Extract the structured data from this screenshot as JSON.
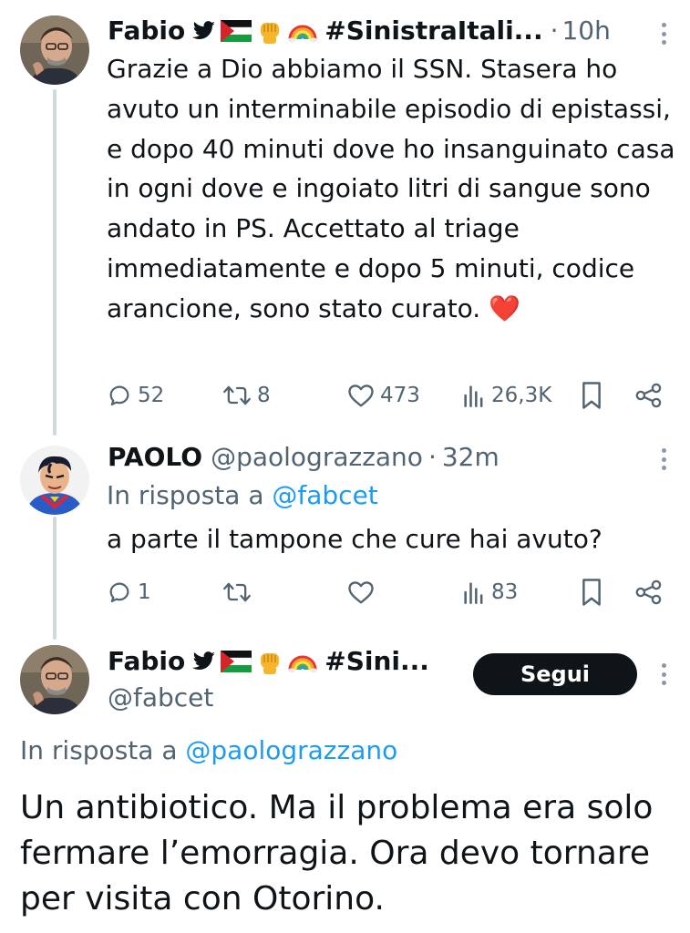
{
  "tweet1": {
    "name": "Fabio",
    "flair_tag": "#SinistraItali...",
    "separator": "·",
    "time": "10h",
    "text": "Grazie a Dio abbiamo il SSN. Stasera ho avuto un interminabile episodio di epistassi, e dopo 40 minuti dove ho insanguinato casa in ogni dove e ingoiato litri di sangue sono andato in PS. Accettato al triage immediatamente e dopo 5 minuti, codice arancione, sono stato curato. ❤️",
    "replies": "52",
    "retweets": "8",
    "likes": "473",
    "views": "26,3K"
  },
  "tweet2": {
    "name": "PAOLO",
    "handle": "@paolograzzano",
    "separator": "·",
    "time": "32m",
    "reply_prefix": "In risposta a",
    "reply_mention": "@fabcet",
    "text": "a parte il tampone che cure hai avuto?",
    "replies": "1",
    "retweets": "",
    "likes": "",
    "views": "83"
  },
  "main_tweet": {
    "name": "Fabio",
    "flair_tag": "#Sini...",
    "handle": "@fabcet",
    "follow_label": "Segui",
    "reply_prefix": "In risposta a",
    "reply_mention": "@paolograzzano",
    "text": "Un antibiotico. Ma il problema era solo fermare l’emorragia. Ora devo tornare per visita con Otorino."
  },
  "icons": {
    "flair": [
      "twitter-bird-icon",
      "palestine-flag-icon",
      "raised-fist-icon",
      "rainbow-icon"
    ],
    "actions": [
      "reply-icon",
      "retweet-icon",
      "like-icon",
      "views-icon",
      "bookmark-icon",
      "share-icon"
    ]
  },
  "colors": {
    "text": "#0f1419",
    "secondary": "#536471",
    "link": "#1d9bf0",
    "thread_line": "#cfd9de",
    "button_bg": "#0f1419"
  }
}
